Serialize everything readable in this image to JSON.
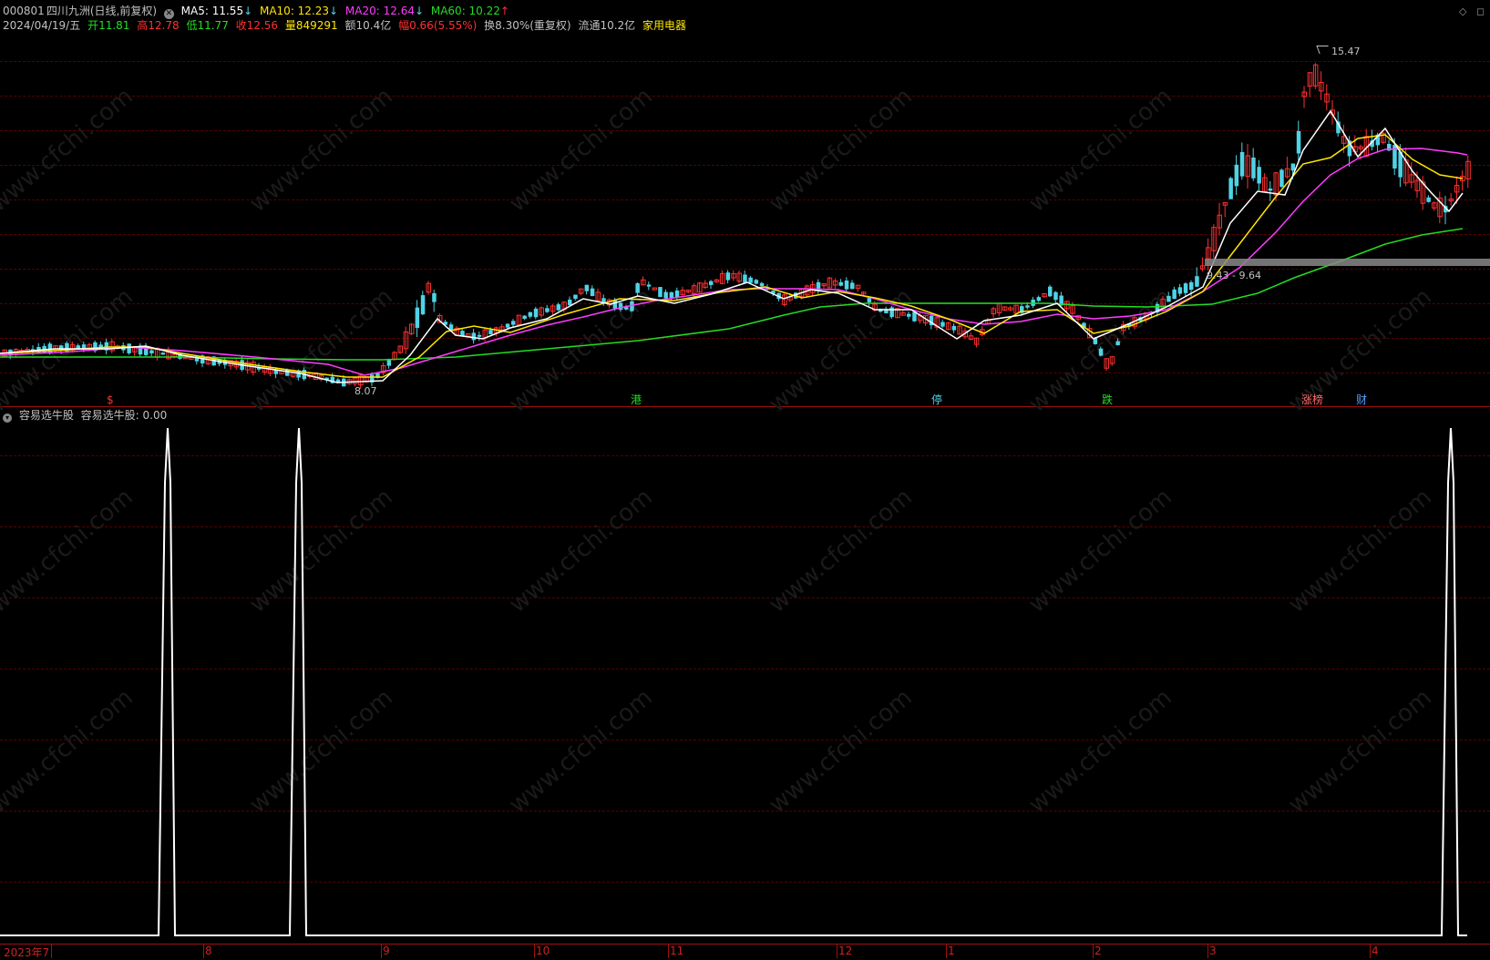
{
  "header": {
    "code": "000801",
    "name": "四川九洲",
    "mode": "(日线,前复权)",
    "ma": [
      {
        "label": "MA5: 11.55",
        "arrow": "↓",
        "color": "#ffffff",
        "arrow_color": "#4fd3e6"
      },
      {
        "label": "MA10: 12.23",
        "arrow": "↓",
        "color": "#ffe600",
        "arrow_color": "#4fd3e6"
      },
      {
        "label": "MA20: 12.64",
        "arrow": "↓",
        "color": "#ff3cff",
        "arrow_color": "#4fd3e6"
      },
      {
        "label": "MA60: 10.22",
        "arrow": "↑",
        "color": "#22dd22",
        "arrow_color": "#ff3030"
      }
    ]
  },
  "info": {
    "date": "2024/04/19/五",
    "open_label": "开",
    "open": "11.81",
    "high_label": "高",
    "high": "12.78",
    "low_label": "低",
    "low": "11.77",
    "close_label": "收",
    "close": "12.56",
    "vol_label": "量",
    "vol": "849291",
    "amt": "额10.4亿",
    "chg_label": "幅",
    "chg": "0.66(5.55%)",
    "turnover": "换8.30%(重复权)",
    "float": "流通10.2亿",
    "sector": "家用电器"
  },
  "price_annotations": {
    "high_mark": "15.47",
    "low_mark": "8.07",
    "range_box": "9.43 - 9.64"
  },
  "event_markers": [
    {
      "text": "$",
      "color": "#ff3030"
    },
    {
      "text": "港",
      "color": "#22dd22"
    },
    {
      "text": "停",
      "color": "#4fd3e6"
    },
    {
      "text": "跌",
      "color": "#22dd22"
    },
    {
      "text": "涨榜",
      "color": "#ff6a6a"
    },
    {
      "text": "财",
      "color": "#4f9fff"
    }
  ],
  "indicator": {
    "name": "容易选牛股",
    "value_label": "容易选牛股: 0.00"
  },
  "x_axis": [
    "2023年7",
    "8",
    "9",
    "10",
    "11",
    "12",
    "1",
    "2",
    "3",
    "4"
  ],
  "watermark": "www.cfchi.com",
  "colors": {
    "up": "#ff3030",
    "down": "#4fd3e6",
    "ma5": "#ffffff",
    "ma10": "#ffe600",
    "ma20": "#ff3cff",
    "ma60": "#22dd22",
    "grid": "#5a0000",
    "axis": "#a01010"
  }
}
